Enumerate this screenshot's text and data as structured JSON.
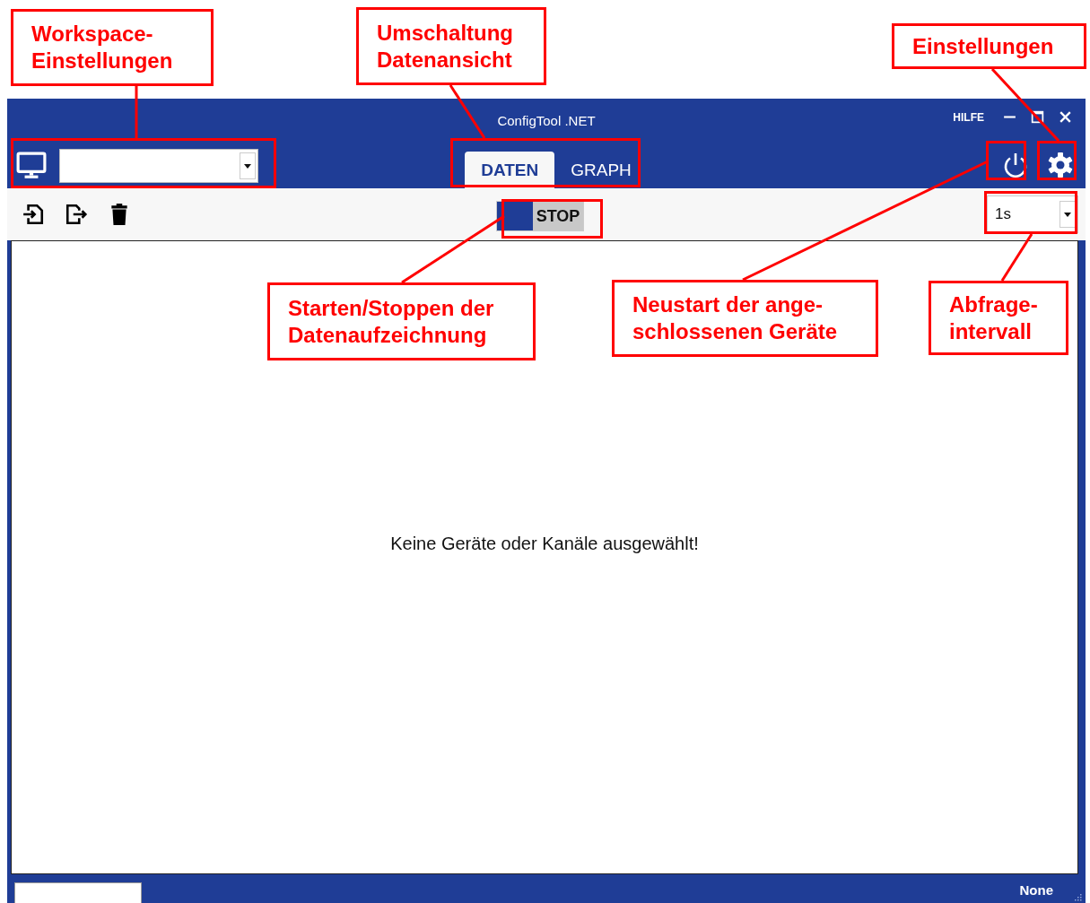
{
  "window": {
    "title": "ConfigTool .NET",
    "help": "HILFE"
  },
  "tabs": [
    {
      "label": "DATEN",
      "selected": true
    },
    {
      "label": "GRAPH",
      "selected": false
    }
  ],
  "toolbar": {
    "stop_button": "STOP",
    "interval": "1s"
  },
  "content": {
    "message": "Keine Geräte oder Kanäle ausgewählt!"
  },
  "status_bar": {
    "text": "None"
  },
  "callouts": [
    {
      "lines": [
        "Workspace-",
        "Einstellungen"
      ]
    },
    {
      "lines": [
        "Umschaltung",
        "Datenansicht"
      ]
    },
    {
      "lines": [
        "Einstellungen"
      ]
    },
    {
      "lines": [
        "Starten/Stoppen der",
        "Datenaufzeichnung"
      ]
    },
    {
      "lines": [
        "Neustart der ange-",
        "schlossenen Geräte"
      ]
    },
    {
      "lines": [
        "Abfrage-",
        "intervall"
      ]
    }
  ]
}
